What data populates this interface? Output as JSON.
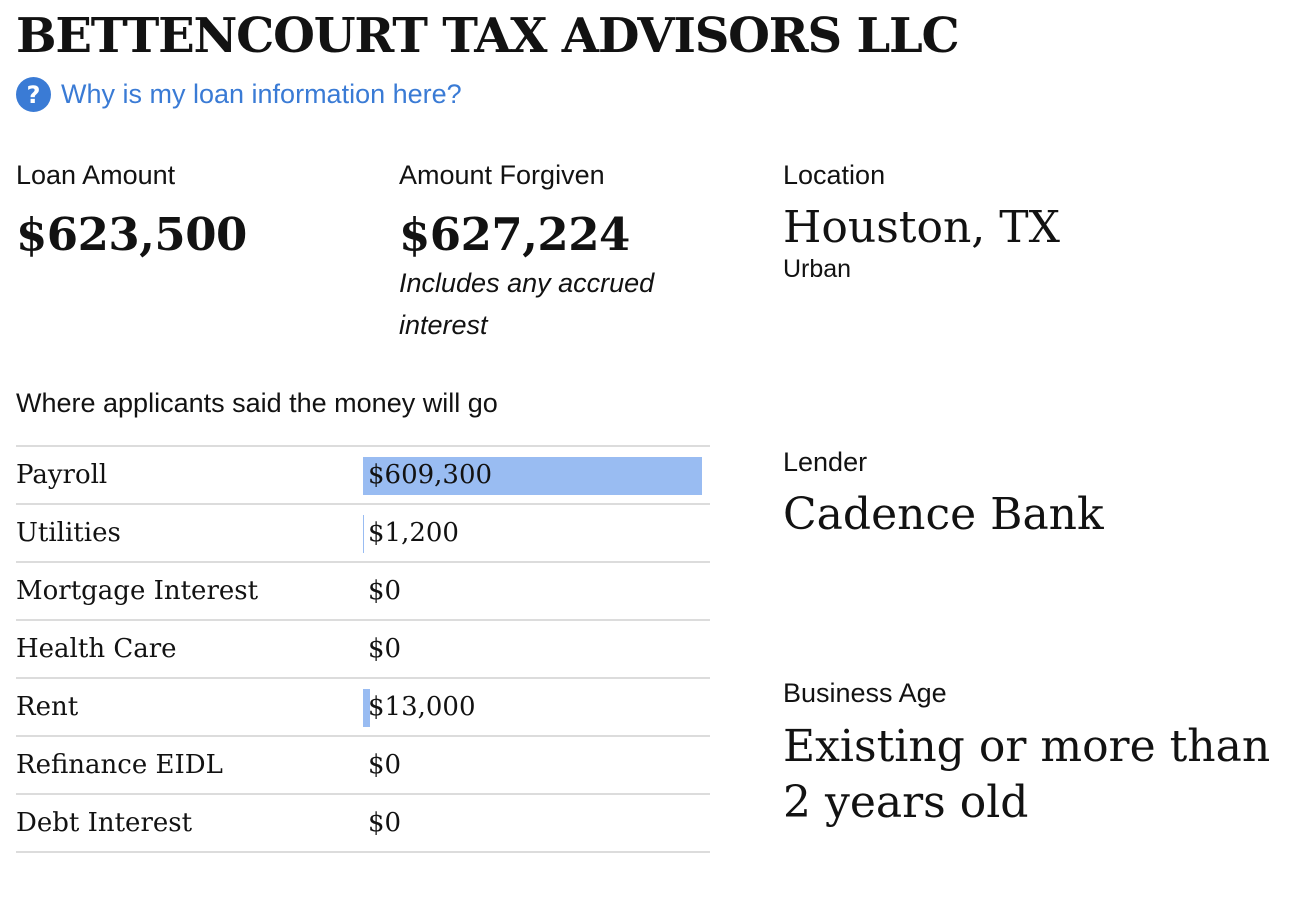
{
  "business": {
    "name": "BETTENCOURT TAX ADVISORS LLC"
  },
  "help": {
    "icon": "question-circle-icon",
    "icon_glyph": "?",
    "link_text": "Why is my loan information here?",
    "color": "#3a7bd5"
  },
  "loan": {
    "amount_label": "Loan Amount",
    "amount": "$623,500",
    "forgiven_label": "Amount Forgiven",
    "forgiven": "$627,224",
    "forgiven_note": "Includes any accrued interest"
  },
  "location": {
    "label": "Location",
    "value": "Houston, TX",
    "sub": "Urban"
  },
  "lender": {
    "label": "Lender",
    "value": "Cadence Bank"
  },
  "business_age": {
    "label": "Business Age",
    "value": "Existing or more than 2 years old"
  },
  "uses": {
    "title": "Where applicants said the money will go",
    "bar_color": "#99bcf2",
    "rows": [
      {
        "category": "Payroll",
        "amount": "$609,300",
        "value": 609300
      },
      {
        "category": "Utilities",
        "amount": "$1,200",
        "value": 1200
      },
      {
        "category": "Mortgage Interest",
        "amount": "$0",
        "value": 0
      },
      {
        "category": "Health Care",
        "amount": "$0",
        "value": 0
      },
      {
        "category": "Rent",
        "amount": "$13,000",
        "value": 13000
      },
      {
        "category": "Refinance EIDL",
        "amount": "$0",
        "value": 0
      },
      {
        "category": "Debt Interest",
        "amount": "$0",
        "value": 0
      }
    ]
  }
}
